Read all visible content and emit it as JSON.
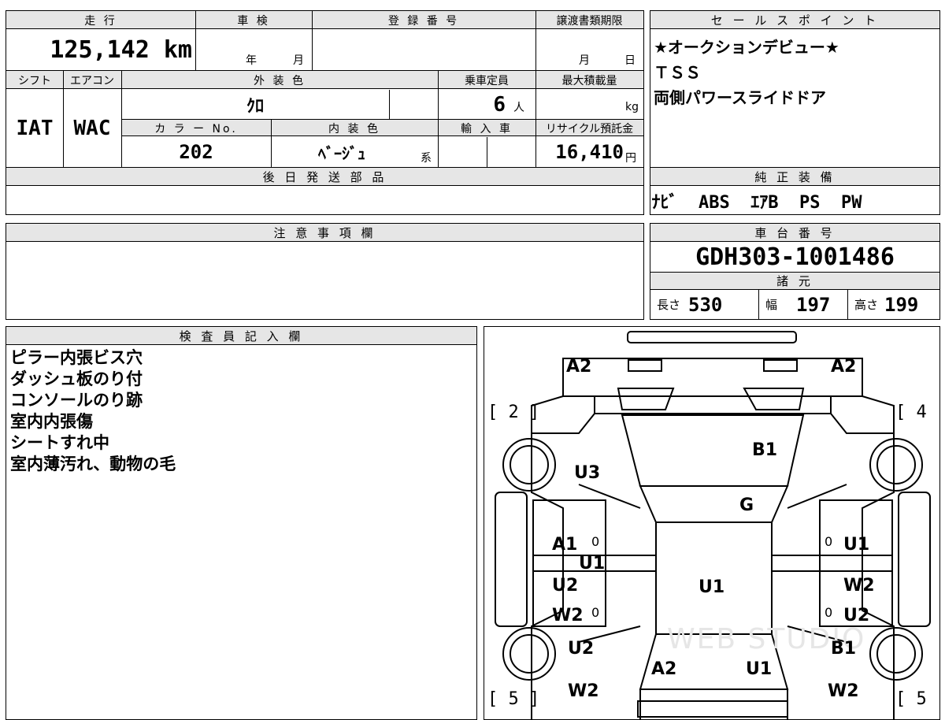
{
  "top_table": {
    "mileage_label": "走 行",
    "mileage_value": "125,142 km",
    "inspection_label": "車 検",
    "inspection_year": "年",
    "inspection_month": "月",
    "registration_label": "登 録 番 号",
    "transfer_deadline_label": "譲渡書類期限",
    "transfer_month": "月",
    "transfer_day": "日",
    "shift_label": "シフト",
    "aircon_label": "エアコン",
    "ext_color_label": "外 装 色",
    "capacity_label": "乗車定員",
    "max_load_label": "最大積載量",
    "shift_value": "IAT",
    "aircon_value": "WAC",
    "ext_color_value": "ｸﾛ",
    "capacity_value": "6",
    "capacity_unit": "人",
    "max_load_unit": "kg",
    "color_no_label": "カ ラ ー No.",
    "int_color_label": "内 装 色",
    "import_label": "輸 入 車",
    "recycle_label": "リサイクル預託金",
    "color_no_value": "202",
    "int_color_value": "ﾍﾞｰｼﾞｭ",
    "int_color_suffix": "系",
    "recycle_value": "16,410",
    "recycle_unit": "円",
    "later_parts_label": "後 日 発 送 部 品"
  },
  "sales_points": {
    "header": "セ ー ル ス ポ イ ン ト",
    "lines": [
      "★オークションデビュー★",
      "ＴＳＳ",
      "両側パワースライドドア"
    ]
  },
  "equipment": {
    "header": "純 正 装 備",
    "value": "ﾅﾋﾞ  ABS  ｴｱB  PS  PW"
  },
  "notes": {
    "header": "注 意 事 項 欄"
  },
  "chassis": {
    "header": "車 台 番 号",
    "value": "GDH303-1001486"
  },
  "specs": {
    "header": "諸 元",
    "length_label": "長さ",
    "length_value": "530",
    "width_label": "幅",
    "width_value": "197",
    "height_label": "高さ",
    "height_value": "199"
  },
  "inspector": {
    "header": "検 査 員 記 入 欄",
    "remarks": [
      "ピラー内張ビス穴",
      "ダッシュ板のり付",
      "コンソールのり跡",
      "室内内張傷",
      "シートすれ中",
      "室内薄汚れ、動物の毛"
    ]
  },
  "diagram": {
    "marks": {
      "a2_left": "A2",
      "a2_right": "A2",
      "b1_top": "B1",
      "u3": "U3",
      "g": "G",
      "a1": "A1",
      "u1_left_a": "U1",
      "u1_left_b": "U1",
      "u2_left": "U2",
      "w2_left": "W2",
      "u1_center": "U1",
      "u1_right": "U1",
      "w2_right": "W2",
      "u2_right": "U2",
      "u2_left_lower": "U2",
      "b1_right": "B1",
      "a2_bottom": "A2",
      "u1_bottom": "U1",
      "w2_left_bottom": "W2",
      "w2_right_bottom": "W2",
      "zero_1": "0",
      "zero_2": "0",
      "zero_3": "0",
      "zero_4": "0"
    },
    "wheel_labels": {
      "front_left": "[ 2 ]",
      "front_right": "[ 4 ]",
      "rear_left": "[ 5 ]",
      "rear_right": "[ 5 ]"
    },
    "watermark": "WEB STUDIO"
  }
}
